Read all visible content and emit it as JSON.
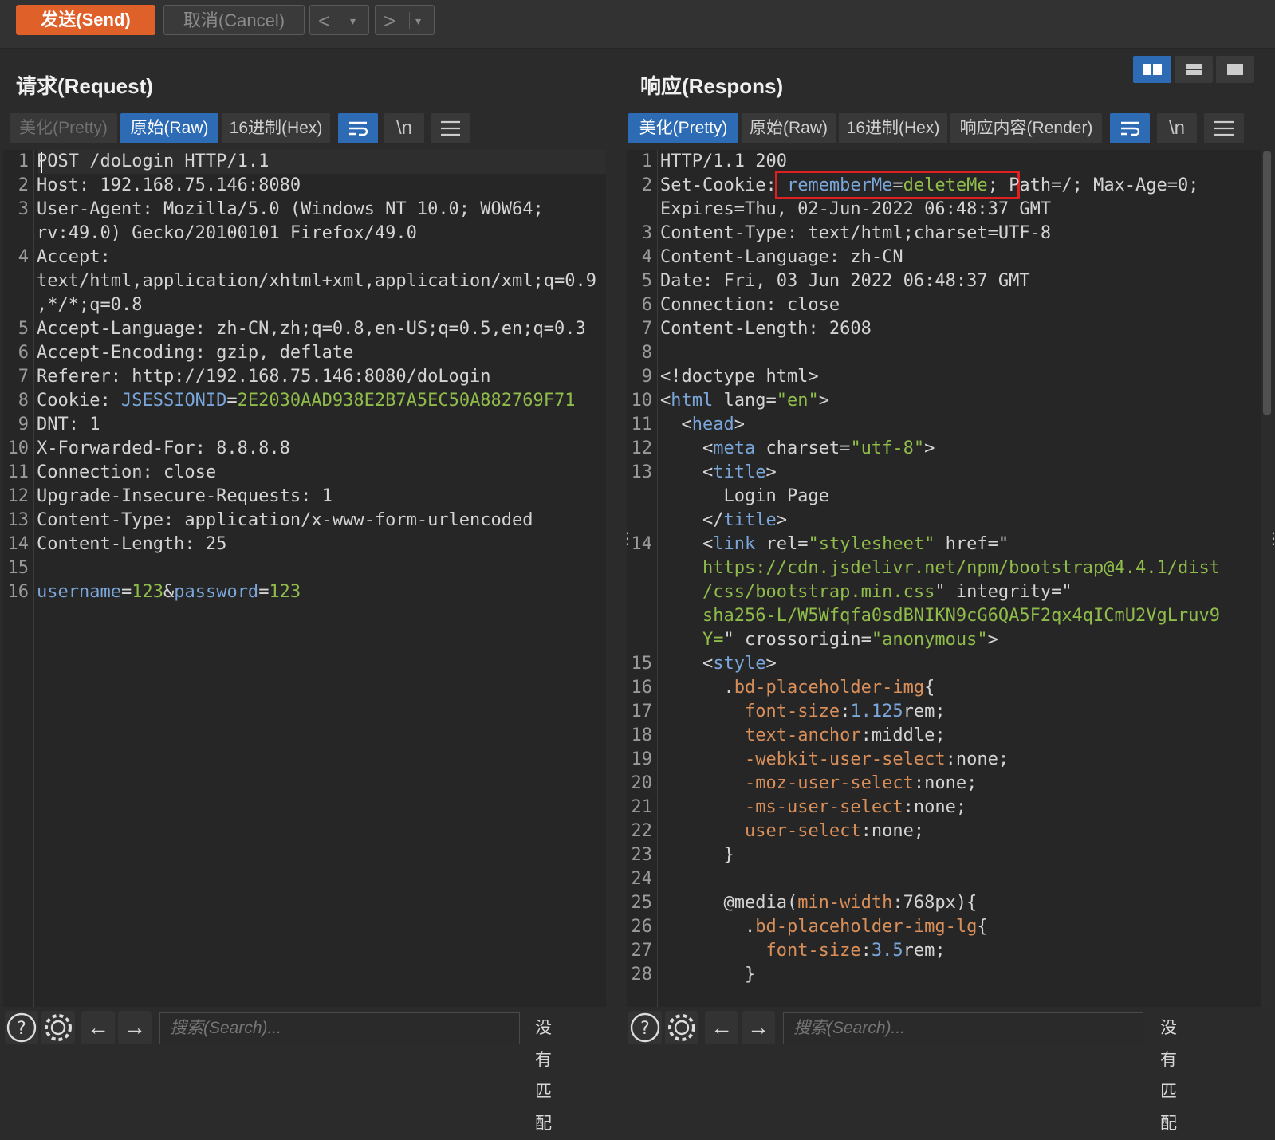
{
  "toolbar": {
    "send_label": "发送(Send)",
    "cancel_label": "取消(Cancel)",
    "back_label": "<",
    "forward_label": ">",
    "dropdown_label": "▾"
  },
  "request": {
    "title": "请求(Request)",
    "tabs": [
      "美化(Pretty)",
      "原始(Raw)",
      "16进制(Hex)"
    ],
    "active_tab": "原始(Raw)",
    "wrap_icon": "wrap-lines-icon",
    "newline_label": "\\n",
    "menu_icon": "menu-icon",
    "lines": [
      {
        "n": "1",
        "segs": [
          [
            "POST /doLogin HTTP/1.1",
            "plain"
          ]
        ]
      },
      {
        "n": "2",
        "segs": [
          [
            "Host: 192.168.75.146:8080",
            "plain"
          ]
        ]
      },
      {
        "n": "3",
        "segs": [
          [
            "User-Agent: Mozilla/5.0 (Windows NT 10.0; WOW64;",
            "plain"
          ]
        ]
      },
      {
        "n": "",
        "segs": [
          [
            "rv:49.0) Gecko/20100101 Firefox/49.0",
            "plain"
          ]
        ]
      },
      {
        "n": "4",
        "segs": [
          [
            "Accept:",
            "plain"
          ]
        ]
      },
      {
        "n": "",
        "segs": [
          [
            "text/html,application/xhtml+xml,application/xml;q=0.9",
            "plain"
          ]
        ]
      },
      {
        "n": "",
        "segs": [
          [
            ",*/*;q=0.8",
            "plain"
          ]
        ]
      },
      {
        "n": "5",
        "segs": [
          [
            "Accept-Language: zh-CN,zh;q=0.8,en-US;q=0.5,en;q=0.3",
            "plain"
          ]
        ]
      },
      {
        "n": "6",
        "segs": [
          [
            "Accept-Encoding: gzip, deflate",
            "plain"
          ]
        ]
      },
      {
        "n": "7",
        "segs": [
          [
            "Referer: http://192.168.75.146:8080/doLogin",
            "plain"
          ]
        ]
      },
      {
        "n": "8",
        "segs": [
          [
            "Cookie: ",
            "plain"
          ],
          [
            "JSESSIONID",
            "blue"
          ],
          [
            "=",
            "plain"
          ],
          [
            "2E2030AAD938E2B7A5EC50A882769F71",
            "green"
          ]
        ]
      },
      {
        "n": "9",
        "segs": [
          [
            "DNT: 1",
            "plain"
          ]
        ]
      },
      {
        "n": "10",
        "segs": [
          [
            "X-Forwarded-For: 8.8.8.8",
            "plain"
          ]
        ]
      },
      {
        "n": "11",
        "segs": [
          [
            "Connection: close",
            "plain"
          ]
        ]
      },
      {
        "n": "12",
        "segs": [
          [
            "Upgrade-Insecure-Requests: 1",
            "plain"
          ]
        ]
      },
      {
        "n": "13",
        "segs": [
          [
            "Content-Type: application/x-www-form-urlencoded",
            "plain"
          ]
        ]
      },
      {
        "n": "14",
        "segs": [
          [
            "Content-Length: 25",
            "plain"
          ]
        ]
      },
      {
        "n": "15",
        "segs": [
          [
            "",
            "plain"
          ]
        ]
      },
      {
        "n": "16",
        "segs": [
          [
            "username",
            "blue"
          ],
          [
            "=",
            "plain"
          ],
          [
            "123",
            "green"
          ],
          [
            "&",
            "plain"
          ],
          [
            "password",
            "blue"
          ],
          [
            "=",
            "plain"
          ],
          [
            "123",
            "green"
          ]
        ]
      }
    ],
    "search_placeholder": "搜索(Search)...",
    "no_match": "没有匹配"
  },
  "response": {
    "title": "响应(Respons)",
    "tabs": [
      "美化(Pretty)",
      "原始(Raw)",
      "16进制(Hex)",
      "响应内容(Render)"
    ],
    "active_tab": "美化(Pretty)",
    "wrap_icon": "wrap-lines-icon",
    "newline_label": "\\n",
    "menu_icon": "menu-icon",
    "lines": [
      {
        "n": "1",
        "segs": [
          [
            "HTTP/1.1 200",
            "plain"
          ]
        ]
      },
      {
        "n": "2",
        "segs": [
          [
            "Set-Cookie: ",
            "plain"
          ],
          [
            "rememberMe",
            "blue"
          ],
          [
            "=",
            "plain"
          ],
          [
            "deleteMe",
            "green"
          ],
          [
            "; Path=/; Max-Age=0;",
            "plain"
          ]
        ]
      },
      {
        "n": "",
        "segs": [
          [
            "Expires=Thu, 02-Jun-2022 06:48:37 GMT",
            "plain"
          ]
        ]
      },
      {
        "n": "3",
        "segs": [
          [
            "Content-Type: text/html;charset=UTF-8",
            "plain"
          ]
        ]
      },
      {
        "n": "4",
        "segs": [
          [
            "Content-Language: zh-CN",
            "plain"
          ]
        ]
      },
      {
        "n": "5",
        "segs": [
          [
            "Date: Fri, 03 Jun 2022 06:48:37 GMT",
            "plain"
          ]
        ]
      },
      {
        "n": "6",
        "segs": [
          [
            "Connection: close",
            "plain"
          ]
        ]
      },
      {
        "n": "7",
        "segs": [
          [
            "Content-Length: 2608",
            "plain"
          ]
        ]
      },
      {
        "n": "8",
        "segs": [
          [
            "",
            "plain"
          ]
        ]
      },
      {
        "n": "9",
        "segs": [
          [
            "<!doctype html>",
            "plain"
          ]
        ]
      },
      {
        "n": "10",
        "segs": [
          [
            "<",
            "plain"
          ],
          [
            "html",
            "blue"
          ],
          [
            " lang=",
            "plain"
          ],
          [
            "\"en\"",
            "green"
          ],
          [
            ">",
            "plain"
          ]
        ]
      },
      {
        "n": "11",
        "segs": [
          [
            "  <",
            "plain"
          ],
          [
            "head",
            "blue"
          ],
          [
            ">",
            "plain"
          ]
        ]
      },
      {
        "n": "12",
        "segs": [
          [
            "    <",
            "plain"
          ],
          [
            "meta",
            "blue"
          ],
          [
            " charset=",
            "plain"
          ],
          [
            "\"utf-8\"",
            "green"
          ],
          [
            ">",
            "plain"
          ]
        ]
      },
      {
        "n": "13",
        "segs": [
          [
            "    <",
            "plain"
          ],
          [
            "title",
            "blue"
          ],
          [
            ">",
            "plain"
          ]
        ]
      },
      {
        "n": "",
        "segs": [
          [
            "      Login Page",
            "plain"
          ]
        ]
      },
      {
        "n": "",
        "segs": [
          [
            "    </",
            "plain"
          ],
          [
            "title",
            "blue"
          ],
          [
            ">",
            "plain"
          ]
        ]
      },
      {
        "n": "14",
        "segs": [
          [
            "    <",
            "plain"
          ],
          [
            "link",
            "blue"
          ],
          [
            " rel=",
            "plain"
          ],
          [
            "\"stylesheet\"",
            "green"
          ],
          [
            " href=\"",
            "plain"
          ]
        ]
      },
      {
        "n": "",
        "segs": [
          [
            "    https://cdn.jsdelivr.net/npm/bootstrap@4.4.1/dist",
            "green"
          ]
        ]
      },
      {
        "n": "",
        "segs": [
          [
            "    /css/bootstrap.min.css",
            "green"
          ],
          [
            "\" integrity=\"",
            "plain"
          ]
        ]
      },
      {
        "n": "",
        "segs": [
          [
            "    sha256-L/W5Wfqfa0sdBNIKN9cG6QA5F2qx4qICmU2VgLruv9",
            "green"
          ]
        ]
      },
      {
        "n": "",
        "segs": [
          [
            "    Y=",
            "green"
          ],
          [
            "\" crossorigin=",
            "plain"
          ],
          [
            "\"anonymous\"",
            "green"
          ],
          [
            ">",
            "plain"
          ]
        ]
      },
      {
        "n": "15",
        "segs": [
          [
            "    <",
            "plain"
          ],
          [
            "style",
            "blue"
          ],
          [
            ">",
            "plain"
          ]
        ]
      },
      {
        "n": "16",
        "segs": [
          [
            "      .",
            "plain"
          ],
          [
            "bd-placeholder-img",
            "orange"
          ],
          [
            "{",
            "plain"
          ]
        ]
      },
      {
        "n": "17",
        "segs": [
          [
            "        ",
            "plain"
          ],
          [
            "font-size",
            "orange"
          ],
          [
            ":",
            "plain"
          ],
          [
            "1.125",
            "blue"
          ],
          [
            "rem;",
            "plain"
          ]
        ]
      },
      {
        "n": "18",
        "segs": [
          [
            "        ",
            "plain"
          ],
          [
            "text-anchor",
            "orange"
          ],
          [
            ":middle;",
            "plain"
          ]
        ]
      },
      {
        "n": "19",
        "segs": [
          [
            "        ",
            "plain"
          ],
          [
            "-webkit-user-select",
            "orange"
          ],
          [
            ":none;",
            "plain"
          ]
        ]
      },
      {
        "n": "20",
        "segs": [
          [
            "        ",
            "plain"
          ],
          [
            "-moz-user-select",
            "orange"
          ],
          [
            ":none;",
            "plain"
          ]
        ]
      },
      {
        "n": "21",
        "segs": [
          [
            "        ",
            "plain"
          ],
          [
            "-ms-user-select",
            "orange"
          ],
          [
            ":none;",
            "plain"
          ]
        ]
      },
      {
        "n": "22",
        "segs": [
          [
            "        ",
            "plain"
          ],
          [
            "user-select",
            "orange"
          ],
          [
            ":none;",
            "plain"
          ]
        ]
      },
      {
        "n": "23",
        "segs": [
          [
            "      }",
            "plain"
          ]
        ]
      },
      {
        "n": "24",
        "segs": [
          [
            "",
            "plain"
          ]
        ]
      },
      {
        "n": "25",
        "segs": [
          [
            "      @media(",
            "plain"
          ],
          [
            "min-width",
            "orange"
          ],
          [
            ":768px){",
            "plain"
          ]
        ]
      },
      {
        "n": "26",
        "segs": [
          [
            "        .",
            "plain"
          ],
          [
            "bd-placeholder-img-lg",
            "orange"
          ],
          [
            "{",
            "plain"
          ]
        ]
      },
      {
        "n": "27",
        "segs": [
          [
            "          ",
            "plain"
          ],
          [
            "font-size",
            "orange"
          ],
          [
            ":",
            "plain"
          ],
          [
            "3.5",
            "blue"
          ],
          [
            "rem;",
            "plain"
          ]
        ]
      },
      {
        "n": "28",
        "segs": [
          [
            "        }",
            "plain"
          ]
        ]
      }
    ],
    "search_placeholder": "搜索(Search)...",
    "no_match": "没有匹配"
  },
  "colors": {
    "accent": "#2d6bb5",
    "send": "#e0602a",
    "highlight_box": "#e02020",
    "string_green": "#8fbc4a",
    "key_blue": "#7aa6da",
    "css_orange": "#d98f5a"
  }
}
